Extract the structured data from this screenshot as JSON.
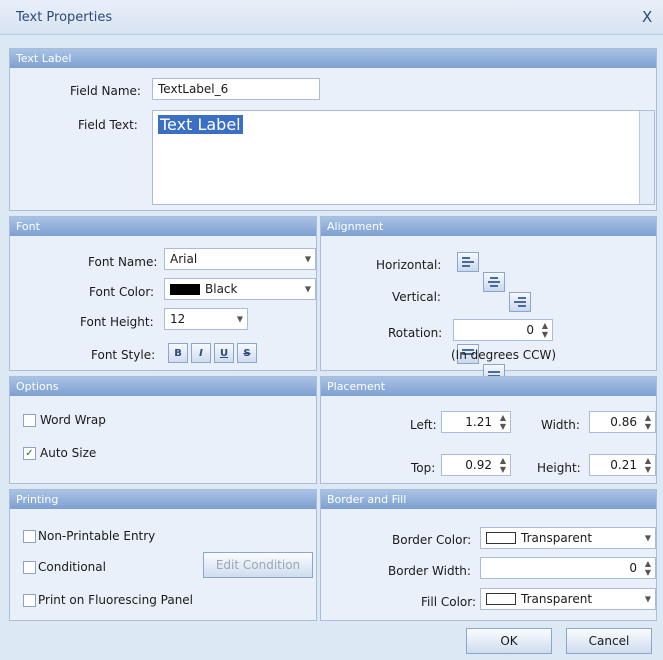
{
  "window": {
    "title": "Text Properties",
    "close_glyph": "X"
  },
  "sections": {
    "text_label": "Text Label",
    "font": "Font",
    "alignment": "Alignment",
    "options": "Options",
    "placement": "Placement",
    "printing": "Printing",
    "border_fill": "Border and Fill"
  },
  "text_label": {
    "field_name_label": "Field Name:",
    "field_name_value": "TextLabel_6",
    "field_text_label": "Field Text:",
    "field_text_value": "Text Label"
  },
  "font": {
    "name_label": "Font Name:",
    "name_value": "Arial",
    "color_label": "Font Color:",
    "color_value": "Black",
    "color_swatch": "#000000",
    "height_label": "Font Height:",
    "height_value": "12",
    "style_label": "Font Style:",
    "style_buttons": [
      "B",
      "I",
      "U",
      "S"
    ]
  },
  "alignment": {
    "horizontal_label": "Horizontal:",
    "vertical_label": "Vertical:",
    "rotation_label": "Rotation:",
    "rotation_value": "0",
    "rotation_note": "(In degrees CCW)"
  },
  "options": {
    "word_wrap_label": "Word Wrap",
    "word_wrap_checked": false,
    "auto_size_label": "Auto Size",
    "auto_size_checked": true
  },
  "placement": {
    "left_label": "Left:",
    "left_value": "1.21",
    "width_label": "Width:",
    "width_value": "0.86",
    "top_label": "Top:",
    "top_value": "0.92",
    "height_label": "Height:",
    "height_value": "0.21"
  },
  "printing": {
    "non_printable_label": "Non-Printable Entry",
    "conditional_label": "Conditional",
    "edit_condition_label": "Edit Condition",
    "fluorescing_label": "Print on Fluorescing Panel"
  },
  "border_fill": {
    "border_color_label": "Border Color:",
    "border_color_value": "Transparent",
    "border_width_label": "Border Width:",
    "border_width_value": "0",
    "fill_color_label": "Fill Color:",
    "fill_color_value": "Transparent"
  },
  "buttons": {
    "ok": "OK",
    "cancel": "Cancel"
  },
  "colors": {
    "header": "#7d9fd0",
    "panel": "#e9f0fa",
    "background": "#dde8f5",
    "selection": "#3a6fc4"
  }
}
